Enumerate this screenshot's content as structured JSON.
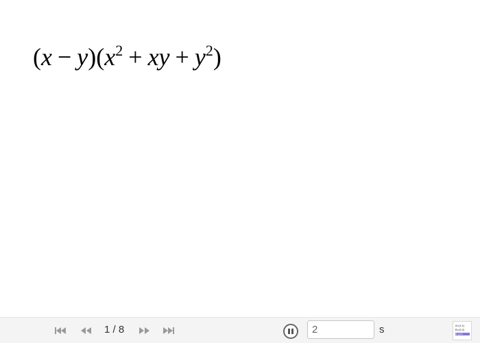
{
  "formula": {
    "open_paren_1": "(",
    "x1": "x",
    "minus": "−",
    "y1": "y",
    "close_open": ")(",
    "x2": "x",
    "exp1": "2",
    "plus1": "+",
    "xy": "xy",
    "plus2": "+",
    "y2": "y",
    "exp2": "2",
    "close_paren": ")"
  },
  "toolbar": {
    "counter": "1 / 8",
    "speed_value": "2",
    "speed_unit": "s",
    "algebra_lines": [
      "A=(1,1)",
      "B=(2,2)",
      "a: y=x"
    ]
  },
  "colors": {
    "toolbar_bg": "#f4f4f4",
    "icon_gray": "#9a9a9a",
    "highlight": "#8a73d6"
  }
}
